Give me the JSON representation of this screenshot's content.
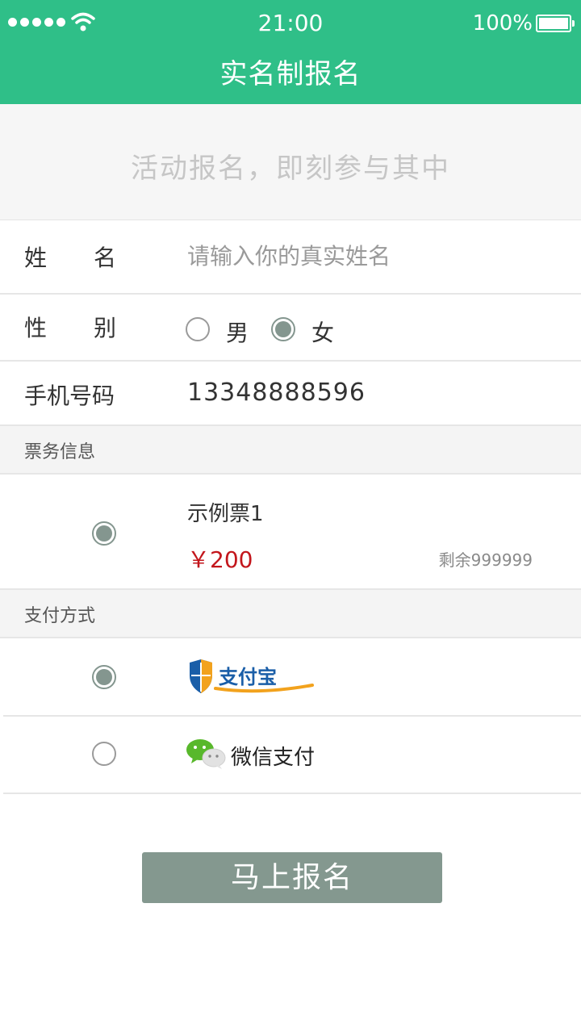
{
  "status_bar": {
    "time": "21:00",
    "battery": "100%"
  },
  "nav": {
    "title": "实名制报名"
  },
  "banner": {
    "text": "活动报名，即刻参与其中"
  },
  "form": {
    "name_label": [
      "姓",
      "名"
    ],
    "name_placeholder": "请输入你的真实姓名",
    "name_value": "",
    "gender_label": [
      "性",
      "别"
    ],
    "gender_options": [
      {
        "label": "男",
        "selected": false
      },
      {
        "label": "女",
        "selected": true
      }
    ],
    "phone_label": "手机号码",
    "phone_value": "13348888596"
  },
  "ticket_section": {
    "title": "票务信息",
    "tickets": [
      {
        "name": "示例票1",
        "price": "￥200",
        "remaining": "剩余999999",
        "selected": true
      }
    ]
  },
  "payment_section": {
    "title": "支付方式",
    "methods": [
      {
        "logo_text": "支付宝",
        "icon": "alipay-logo",
        "selected": true
      },
      {
        "label": "微信支付",
        "icon": "wechat-icon",
        "selected": false
      }
    ]
  },
  "submit": {
    "label": "马上报名"
  },
  "colors": {
    "header": "#2fbf88",
    "radio_selected": "#84968f",
    "price": "#c3161c",
    "button": "#84988f"
  }
}
